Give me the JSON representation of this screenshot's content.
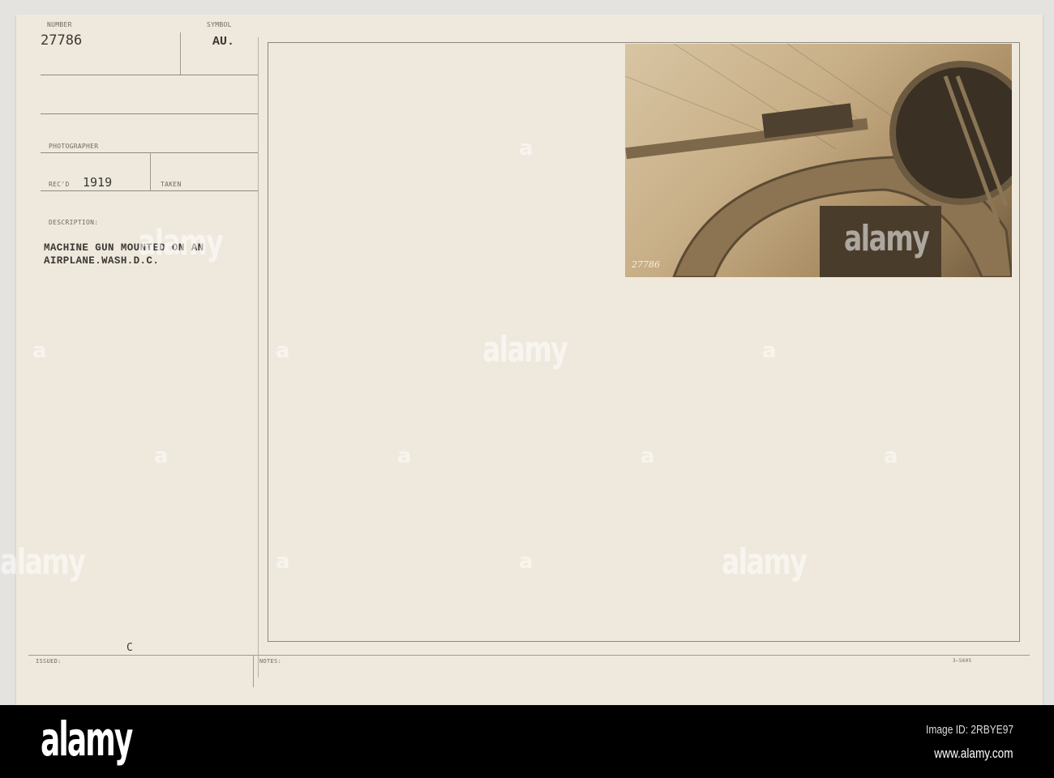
{
  "card": {
    "number_label": "NUMBER",
    "number_value": "27786",
    "symbol_label": "SYMBOL",
    "symbol_value": "AU.",
    "photographer_label": "PHOTOGRAPHER",
    "recd_label": "REC'D",
    "recd_value": "1919",
    "taken_label": "TAKEN",
    "description_label": "DESCRIPTION:",
    "description_line1": "MACHINE GUN MOUNTED ON AN",
    "description_line2": "AIRPLANE.WASH.D.C.",
    "issued_label": "ISSUED:",
    "issued_mark": "C",
    "notes_label": "NOTES:",
    "form_number": "3—5605",
    "photo_number": "27786"
  },
  "watermark": "alamy",
  "watermark_letter": "a",
  "footer": {
    "logo": "alamy",
    "image_id": "Image ID: 2RBYE97",
    "url": "www.alamy.com"
  },
  "colors": {
    "card": "#efe9dd",
    "sepia": "#c7ae86",
    "footer": "#000000"
  }
}
